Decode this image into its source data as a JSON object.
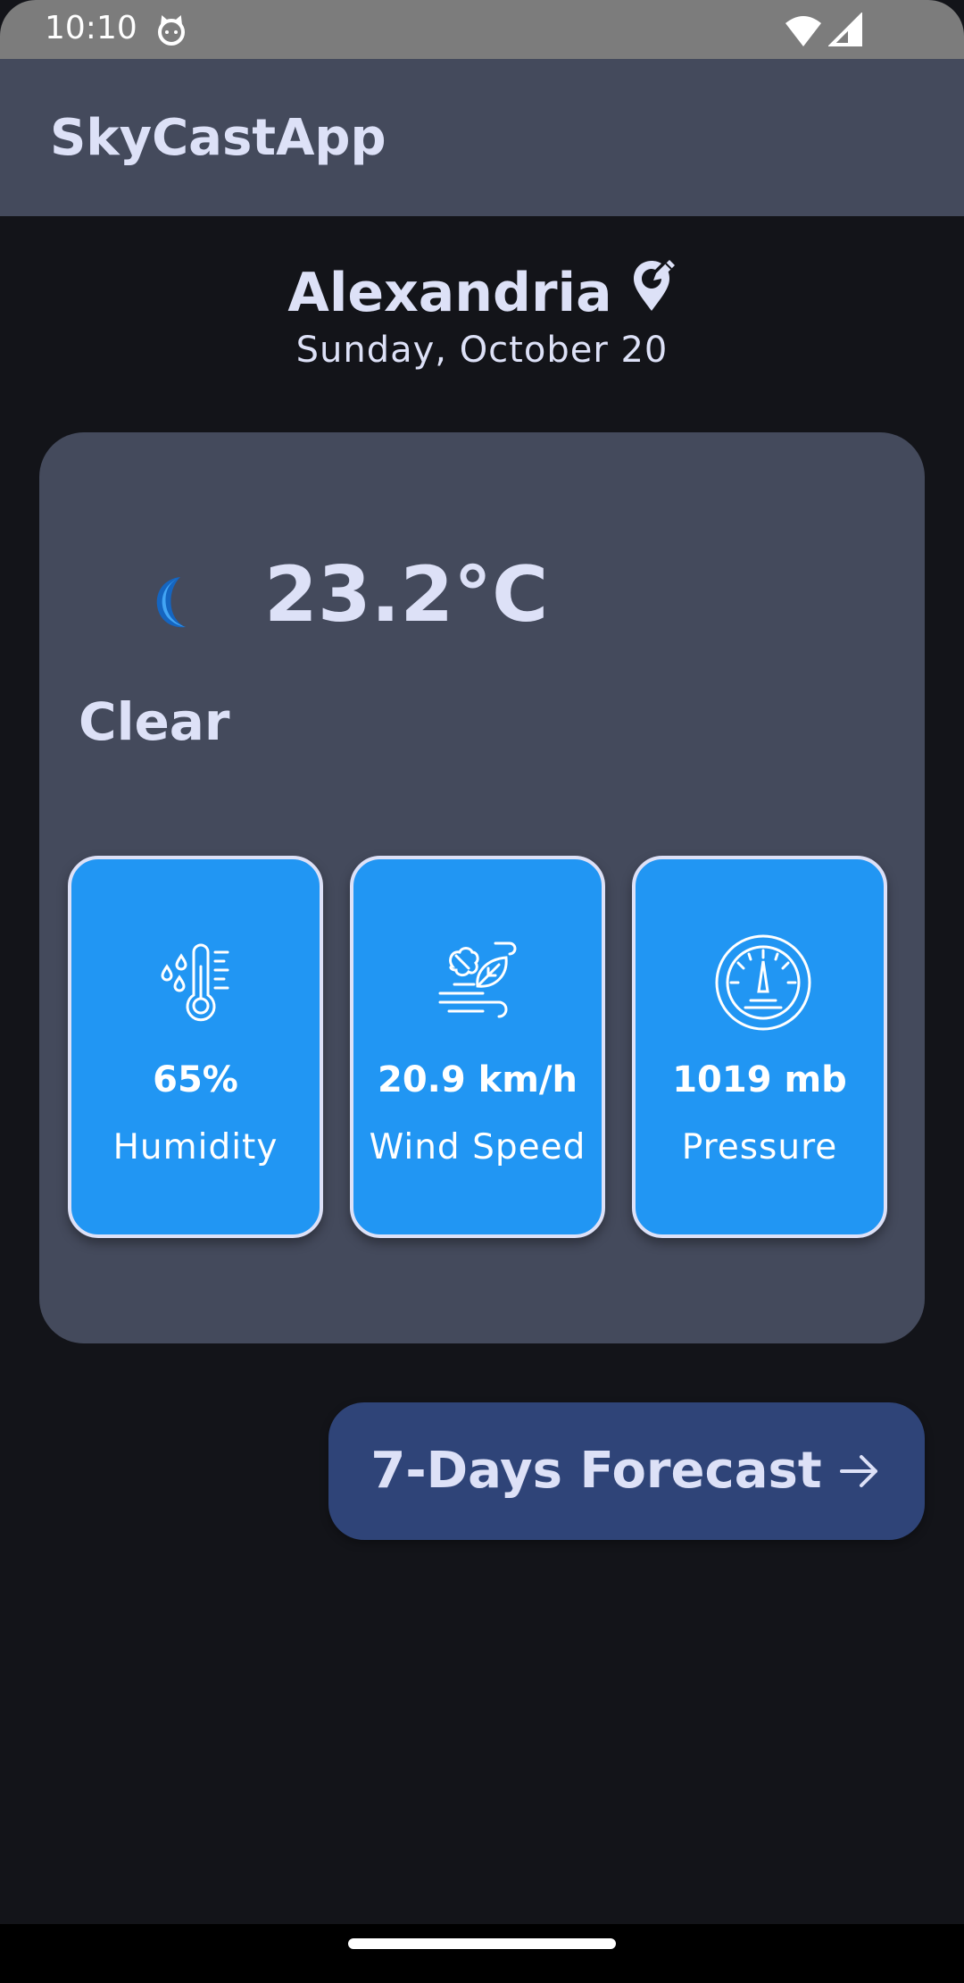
{
  "status_bar": {
    "time": "10:10",
    "icons": [
      "cat-icon",
      "wifi-icon",
      "signal-icon"
    ]
  },
  "app_bar": {
    "title": "SkyCastApp"
  },
  "location": {
    "city": "Alexandria",
    "date": "Sunday, October 20",
    "edit_icon": "edit-location-icon"
  },
  "weather": {
    "icon": "moon-icon",
    "temperature": "23.2°C",
    "condition": "Clear"
  },
  "stats": [
    {
      "icon": "humidity-thermometer-icon",
      "value": "65%",
      "label": "Humidity"
    },
    {
      "icon": "wind-leaf-icon",
      "value": "20.9 km/h",
      "label": "Wind Speed"
    },
    {
      "icon": "pressure-gauge-icon",
      "value": "1019 mb",
      "label": "Pressure"
    }
  ],
  "forecast_button": {
    "label": "7-Days Forecast",
    "icon": "arrow-right-icon"
  },
  "colors": {
    "background": "#131419",
    "card": "#444a5c",
    "tile": "#2196f3",
    "button": "#2f4478",
    "text": "#dde1f7"
  }
}
